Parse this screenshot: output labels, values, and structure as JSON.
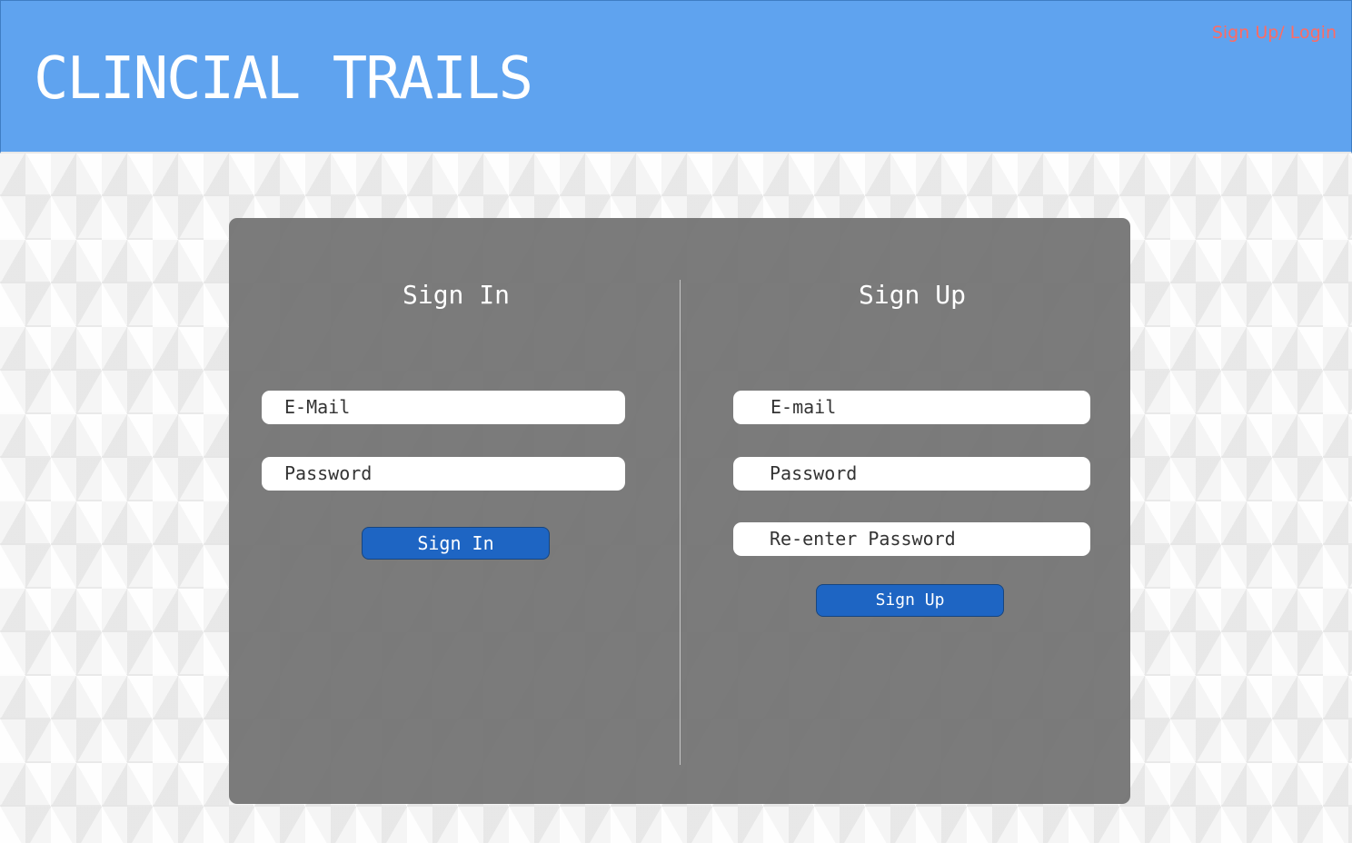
{
  "header": {
    "title": "CLINCIAL TRAILS",
    "nav_link": "Sign Up/ Login",
    "background_color": "#5fa3ef",
    "link_color": "#ff6b63"
  },
  "sign_in": {
    "title": "Sign In",
    "email_placeholder": "E-Mail",
    "password_placeholder": "Password",
    "submit_label": "Sign In"
  },
  "sign_up": {
    "title": "Sign Up",
    "email_placeholder": "E-mail",
    "password_placeholder": "Password",
    "reenter_placeholder": "Re-enter Password",
    "submit_label": "Sign Up"
  },
  "colors": {
    "panel": "#767676",
    "button": "#1e65c3"
  }
}
